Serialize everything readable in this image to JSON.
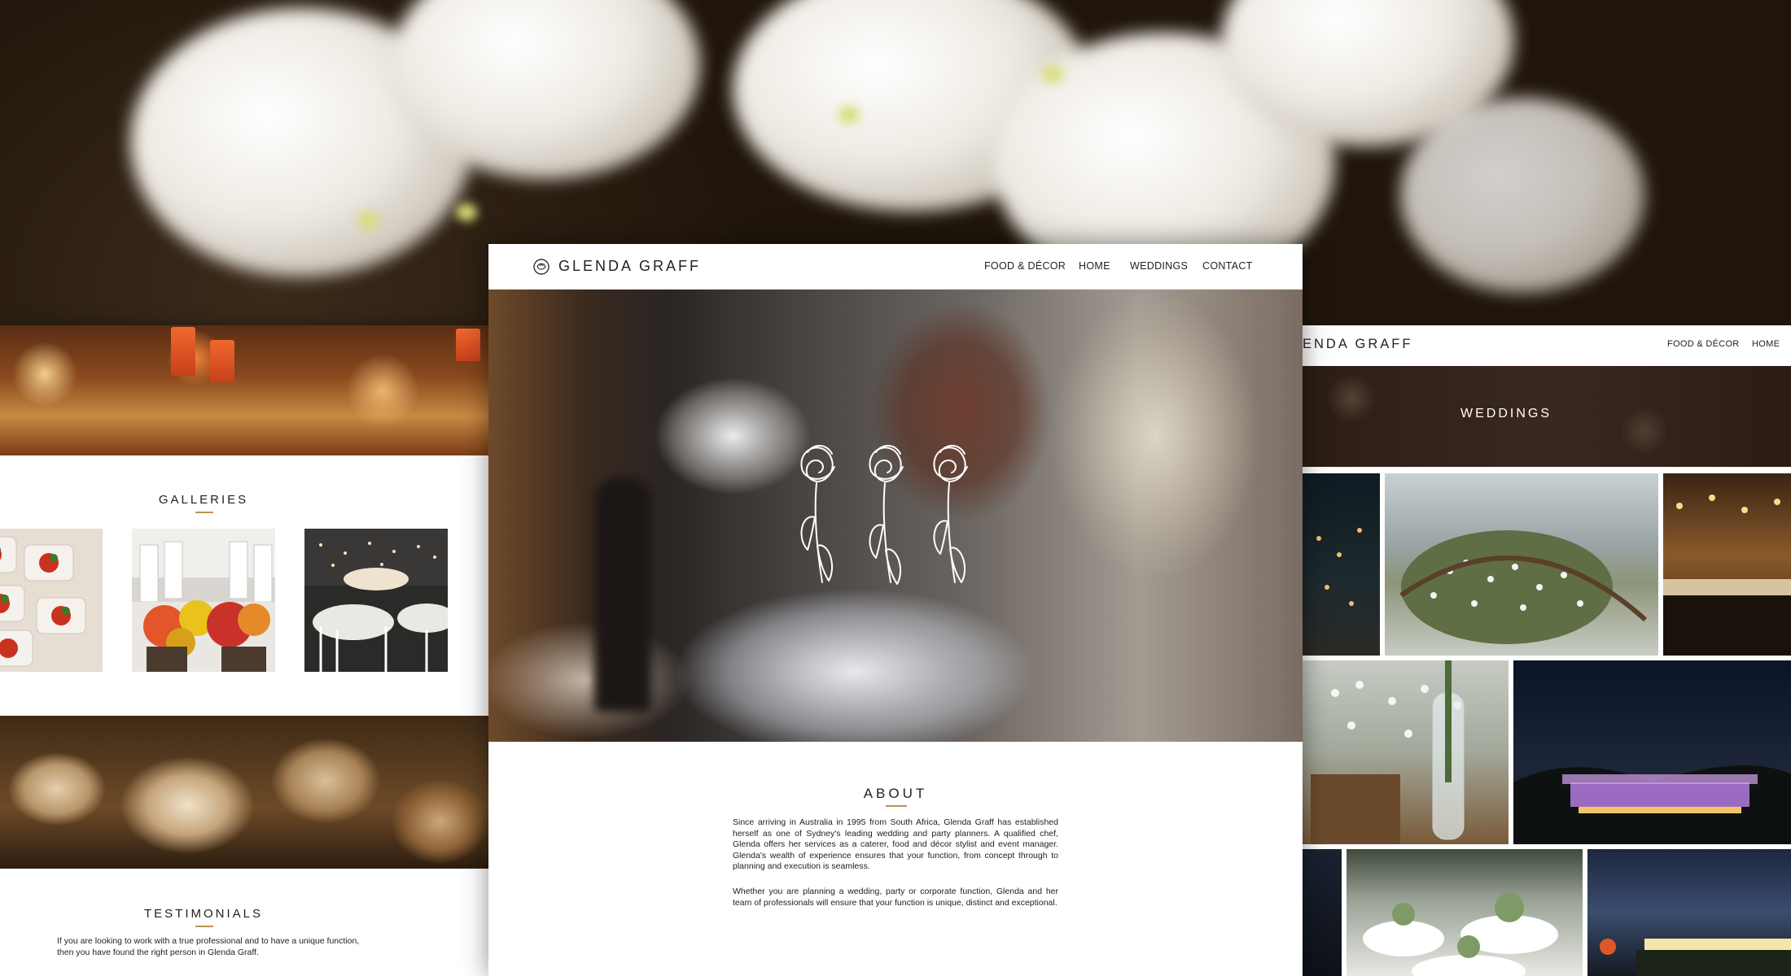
{
  "site": {
    "logo_text": "GLENDA GRAFF",
    "nav": [
      "FOOD & DÉCOR",
      "HOME",
      "WEDDINGS",
      "CONTACT"
    ]
  },
  "left_page": {
    "galleries_title": "GALLERIES",
    "testimonials_title": "TESTIMONIALS",
    "testimonial_text": "If you are looking to work with a true professional and to have a unique function, then you have found the right person in Glenda Graff."
  },
  "center_page": {
    "about_title": "ABOUT",
    "about_paragraph_1": "Since arriving in Australia in 1995 from South Africa, Glenda Graff has established herself as one of Sydney's leading wedding and party planners. A qualified chef, Glenda offers her services as a caterer, food and décor stylist and event manager. Glenda's wealth of experience ensures that your function, from concept through to planning and execution is seamless.",
    "about_paragraph_2": "Whether you are planning a wedding, party or corporate function, Glenda and her team of professionals will ensure that your function is unique, distinct and exceptional."
  },
  "right_page": {
    "logo_text_cropped": "ENDA GRAFF",
    "nav": [
      "FOOD & DÉCOR",
      "HOME"
    ],
    "banner_title": "WEDDINGS"
  },
  "colors": {
    "accent_gold": "#b9925a",
    "text_dark": "#222222",
    "white": "#ffffff"
  },
  "icons": {
    "logo": "rose-logo-icon",
    "hero_emblem": "three-roses-icon"
  }
}
